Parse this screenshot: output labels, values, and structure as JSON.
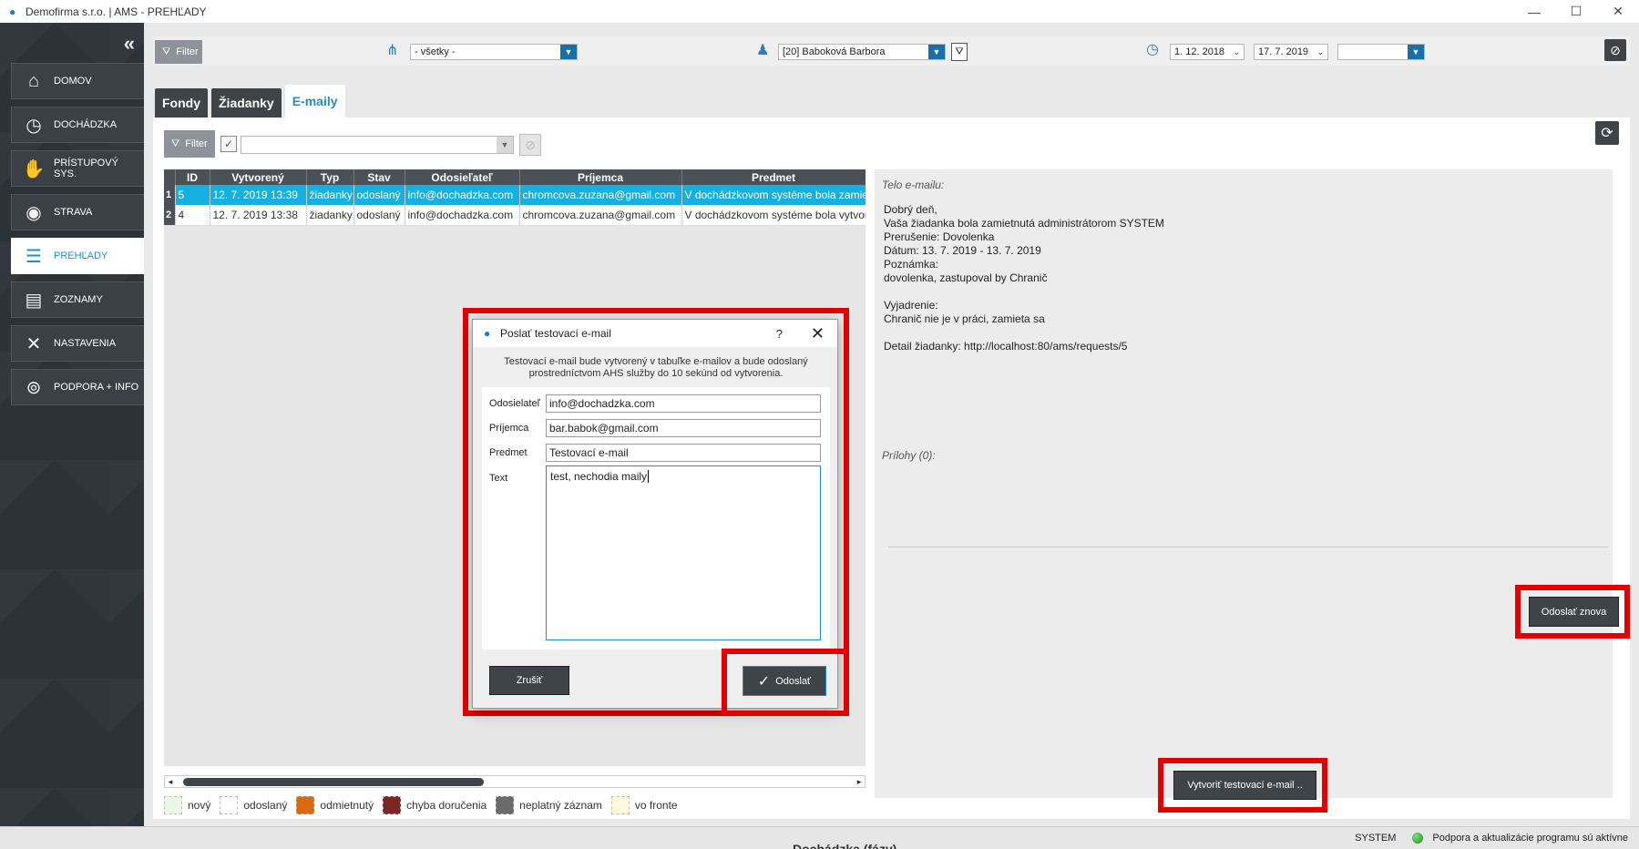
{
  "window": {
    "title": "Demofirma s.r.o. | AMS - PREHĽADY",
    "controls": {
      "minimize": "—",
      "maximize": "☐",
      "close": "✕"
    }
  },
  "sidebar": {
    "collapse_icon": "«",
    "items": [
      {
        "label": "DOMOV",
        "icon": "home-icon",
        "glyph": "⌂"
      },
      {
        "label": "DOCHÁDZKA",
        "icon": "clock-icon",
        "glyph": "◷"
      },
      {
        "label": "PRÍSTUPOVÝ SYS.",
        "icon": "handshake-icon",
        "glyph": "✋"
      },
      {
        "label": "STRAVA",
        "icon": "plate-icon",
        "glyph": "◉"
      },
      {
        "label": "PREHĽADY",
        "icon": "book-search-icon",
        "glyph": "☰",
        "active": true
      },
      {
        "label": "ZOZNAMY",
        "icon": "list-icon",
        "glyph": "▤"
      },
      {
        "label": "NASTAVENIA",
        "icon": "tools-icon",
        "glyph": "✕"
      },
      {
        "label": "PODPORA + INFO",
        "icon": "lifebuoy-icon",
        "glyph": "⊚"
      }
    ]
  },
  "toolbar": {
    "filter_label": "Filter",
    "group_select": "- všetky -",
    "person_select": "[20] Baboková Barbora",
    "date_from": "1. 12. 2018",
    "date_to": "17. 7. 2019",
    "extra_select": ""
  },
  "tabs": [
    {
      "label": "Fondy",
      "active": false
    },
    {
      "label": "Žiadanky",
      "active": false
    },
    {
      "label": "E-maily",
      "active": true
    }
  ],
  "subbar": {
    "filter_label": "Filter",
    "filter_value": ""
  },
  "table": {
    "columns": [
      "ID",
      "Vytvorený",
      "Typ",
      "Stav",
      "Odosieľateľ",
      "Príjemca",
      "Predmet"
    ],
    "rows": [
      {
        "rownum": "1",
        "id": "5",
        "created": "12. 7. 2019  13:39",
        "type": "žiadanky",
        "state": "odoslaný",
        "sender": "info@dochadzka.com",
        "recipient": "chromcova.zuzana@gmail.com",
        "subject": "V dochádzkovom systéme bola zamietnutá",
        "selected": true
      },
      {
        "rownum": "2",
        "id": "4",
        "created": "12. 7. 2019  13:38",
        "type": "žiadanky",
        "state": "odoslaný",
        "sender": "info@dochadzka.com",
        "recipient": "chromcova.zuzana@gmail.com",
        "subject": "V dochádzkovom systéme bola vytvorená",
        "selected": false
      }
    ]
  },
  "legend": [
    {
      "label": "nový",
      "color": "#eaf7e6"
    },
    {
      "label": "odoslaný",
      "color": "#ffffff"
    },
    {
      "label": "odmietnutý",
      "color": "#d86a12"
    },
    {
      "label": "chyba doručenia",
      "color": "#7a2626"
    },
    {
      "label": "neplatný záznam",
      "color": "#6b6b6b"
    },
    {
      "label": "vo fronte",
      "color": "#fdf7dc"
    }
  ],
  "detail": {
    "header": "Telo e-mailu:",
    "body": "Dobrý deň,\nVaša žiadanka bola zamietnutá administrátorom SYSTEM\nPrerušenie: Dovolenka\nDátum: 13. 7. 2019 - 13. 7. 2019\nPoznámka:\ndovolenka, zastupoval by Chranič\n\nVyjadrenie:\nChranič nie je v práci, zamieta sa\n\nDetail žiadanky: http://localhost:80/ams/requests/5",
    "attachments": "Prílohy (0):",
    "resend_label": "Odoslať znova",
    "create_test_label": "Vytvoriť testovací e-mail .."
  },
  "dialog": {
    "title": "Poslať testovací e-mail",
    "help": "?",
    "close": "✕",
    "info": "Testovací e-mail bude vytvorený v tabuľke e-mailov a bude odoslaný prostredníctvom AHS služby do 10 sekúnd od vytvorenia.",
    "sender_label": "Odosielateľ",
    "sender_value": "info@dochadzka.com",
    "recipient_label": "Príjemca",
    "recipient_value": "bar.babok@gmail.com",
    "subject_label": "Predmet",
    "subject_value": "Testovací e-mail",
    "text_label": "Text",
    "text_value": "test, nechodia maily",
    "cancel_label": "Zrušiť",
    "send_label": "Odoslať",
    "send_icon": "✓"
  },
  "statusbar": {
    "user": "SYSTEM",
    "message": "Podpora a aktualizácie programu sú aktívne",
    "partial_text": "Dochádzka (fázy)"
  },
  "colors": {
    "accent": "#1d8fc4",
    "selection": "#14b0e0",
    "highlight": "#e30000",
    "dark": "#3e4448"
  }
}
